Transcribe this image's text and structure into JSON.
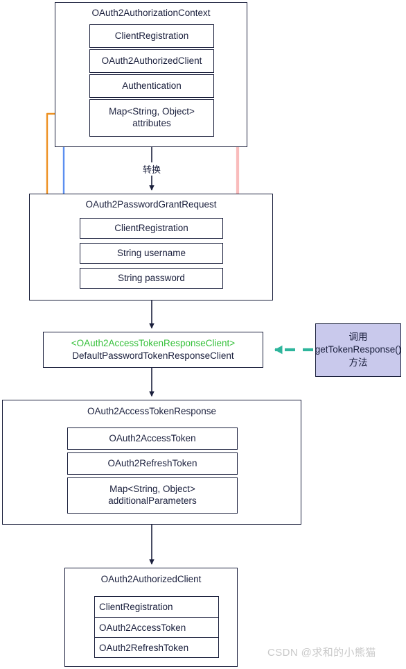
{
  "diagram": {
    "title": "OAuth2 password grant flow",
    "colors": {
      "box_border": "#1a1f3c",
      "generic_text": "#35c03a",
      "callout_fill": "#c9c9ec",
      "pink_connector": "#f9bcbc",
      "blue_connector": "#5b8ff0",
      "orange_connector": "#ed9122",
      "teal_connector": "#2eb59c",
      "arrow_black": "#1a1f3c",
      "watermark": "#c9c9c9"
    }
  },
  "nodes": {
    "context": {
      "title": "OAuth2AuthorizationContext",
      "fields": [
        "ClientRegistration",
        "OAuth2AuthorizedClient",
        "Authentication",
        "Map<String, Object>\nattributes"
      ]
    },
    "request": {
      "title": "OAuth2PasswordGrantRequest",
      "fields": [
        "ClientRegistration",
        "String username",
        "String password"
      ]
    },
    "client": {
      "generic": "<OAuth2AccessTokenResponseClient>",
      "implementation": "DefaultPasswordTokenResponseClient"
    },
    "callout": {
      "text": "调用\ngetTokenResponse()\n方法"
    },
    "response": {
      "title": "OAuth2AccessTokenResponse",
      "fields": [
        "OAuth2AccessToken",
        "OAuth2RefreshToken",
        "Map<String, Object>\nadditionalParameters"
      ]
    },
    "authorized": {
      "title": "OAuth2AuthorizedClient",
      "rows": [
        "ClientRegistration",
        "OAuth2AccessToken",
        "OAuth2RefreshToken"
      ]
    }
  },
  "edges": {
    "transform_label": "转换"
  },
  "watermark": "CSDN @求和的小熊猫"
}
